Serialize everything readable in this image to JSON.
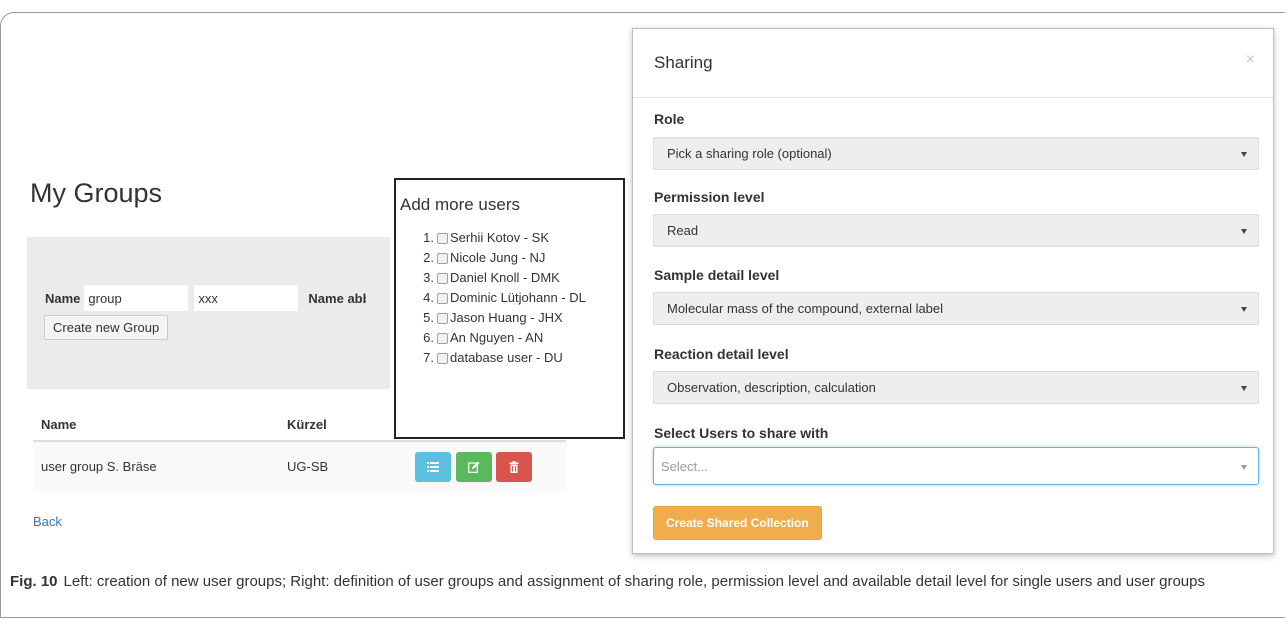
{
  "left": {
    "title": "My Groups",
    "form": {
      "name_label": "Name",
      "name_value": "group",
      "second_value": "xxx",
      "abbr_label": "Name abbrev",
      "create_button": "Create new Group"
    },
    "table": {
      "headers": [
        "Name",
        "Kürzel"
      ],
      "rows": [
        {
          "name": "user group S. Bräse",
          "kuerzel": "UG-SB"
        }
      ]
    },
    "back_link": "Back"
  },
  "add_users": {
    "title": "Add more users",
    "users": [
      {
        "num": "1.",
        "label": "Serhii Kotov - SK"
      },
      {
        "num": "2.",
        "label": "Nicole Jung - NJ"
      },
      {
        "num": "3.",
        "label": "Daniel Knoll - DMK"
      },
      {
        "num": "4.",
        "label": "Dominic Lütjohann - DL"
      },
      {
        "num": "5.",
        "label": "Jason Huang - JHX"
      },
      {
        "num": "6.",
        "label": "An Nguyen - AN"
      },
      {
        "num": "7.",
        "label": "database user - DU"
      }
    ]
  },
  "modal": {
    "title": "Sharing",
    "close": "×",
    "role_label": "Role",
    "role_value": "Pick a sharing role (optional)",
    "permission_label": "Permission level",
    "permission_value": "Read",
    "sample_label": "Sample detail level",
    "sample_value": "Molecular mass of the compound, external label",
    "reaction_label": "Reaction detail level",
    "reaction_value": "Observation, description, calculation",
    "users_label": "Select Users to share with",
    "users_placeholder": "Select...",
    "create_button": "Create Shared Collection"
  },
  "caption": {
    "fig": "Fig. 10",
    "text": "Left: creation of new user groups; Right: definition of user groups and assignment of sharing role, permission level and available detail level for single users and user groups"
  },
  "colors": {
    "info": "#5bc0de",
    "success": "#5cb85c",
    "danger": "#d9534f",
    "warning": "#f0ad4e",
    "link": "#337ab7"
  }
}
